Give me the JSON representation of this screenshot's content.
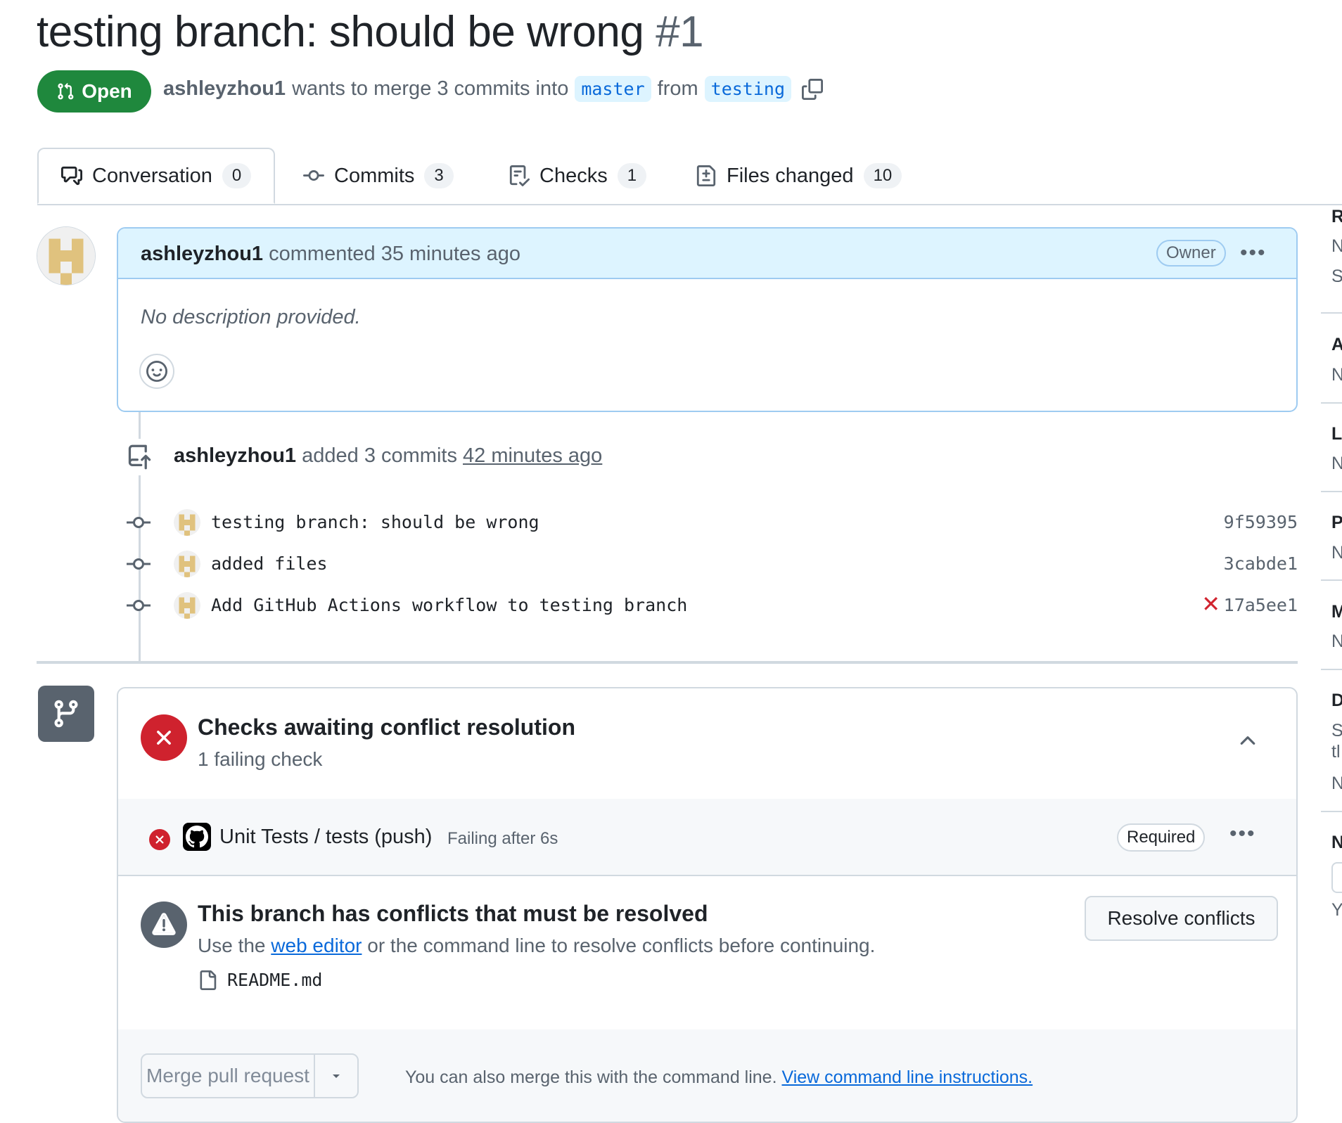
{
  "pr": {
    "title": "testing branch: should be wrong",
    "number": "#1",
    "state": "Open",
    "author": "ashleyzhou1",
    "merge_text": "wants to merge 3 commits into",
    "base_branch": "master",
    "from_text": "from",
    "head_branch": "testing"
  },
  "tabs": [
    {
      "label": "Conversation",
      "count": "0"
    },
    {
      "label": "Commits",
      "count": "3"
    },
    {
      "label": "Checks",
      "count": "1"
    },
    {
      "label": "Files changed",
      "count": "10"
    }
  ],
  "comment": {
    "author": "ashleyzhou1",
    "meta": "commented 35 minutes ago",
    "role": "Owner",
    "body": "No description provided."
  },
  "push_event": {
    "author": "ashleyzhou1",
    "action": "added 3 commits",
    "time": "42 minutes ago"
  },
  "commits": [
    {
      "message": "testing branch: should be wrong",
      "sha": "9f59395",
      "failed": false
    },
    {
      "message": "added files",
      "sha": "3cabde1",
      "failed": false
    },
    {
      "message": "Add GitHub Actions workflow to testing branch",
      "sha": "17a5ee1",
      "failed": true
    }
  ],
  "checks": {
    "title": "Checks awaiting conflict resolution",
    "subtitle": "1 failing check",
    "run_name": "Unit Tests / tests (push)",
    "run_status": "Failing after 6s",
    "run_badge": "Required"
  },
  "conflict": {
    "title": "This branch has conflicts that must be resolved",
    "desc_before": "Use the",
    "desc_link": "web editor",
    "desc_after": "or the command line to resolve conflicts before continuing.",
    "button": "Resolve conflicts",
    "file": "README.md"
  },
  "merge": {
    "button": "Merge pull request",
    "hint": "You can also merge this with the command line.",
    "hint_link": "View command line instructions."
  },
  "sidebar_fragments": [
    "R",
    "N",
    "S",
    "A",
    "N",
    "L",
    "N",
    "P",
    "N",
    "M",
    "N",
    "D",
    "S",
    "tl",
    "N",
    "N",
    "Y"
  ],
  "colors": {
    "open_green": "#1f883d",
    "fail_red": "#cf222e",
    "link_blue": "#0969da",
    "comment_header_bg": "#ddf4ff"
  }
}
